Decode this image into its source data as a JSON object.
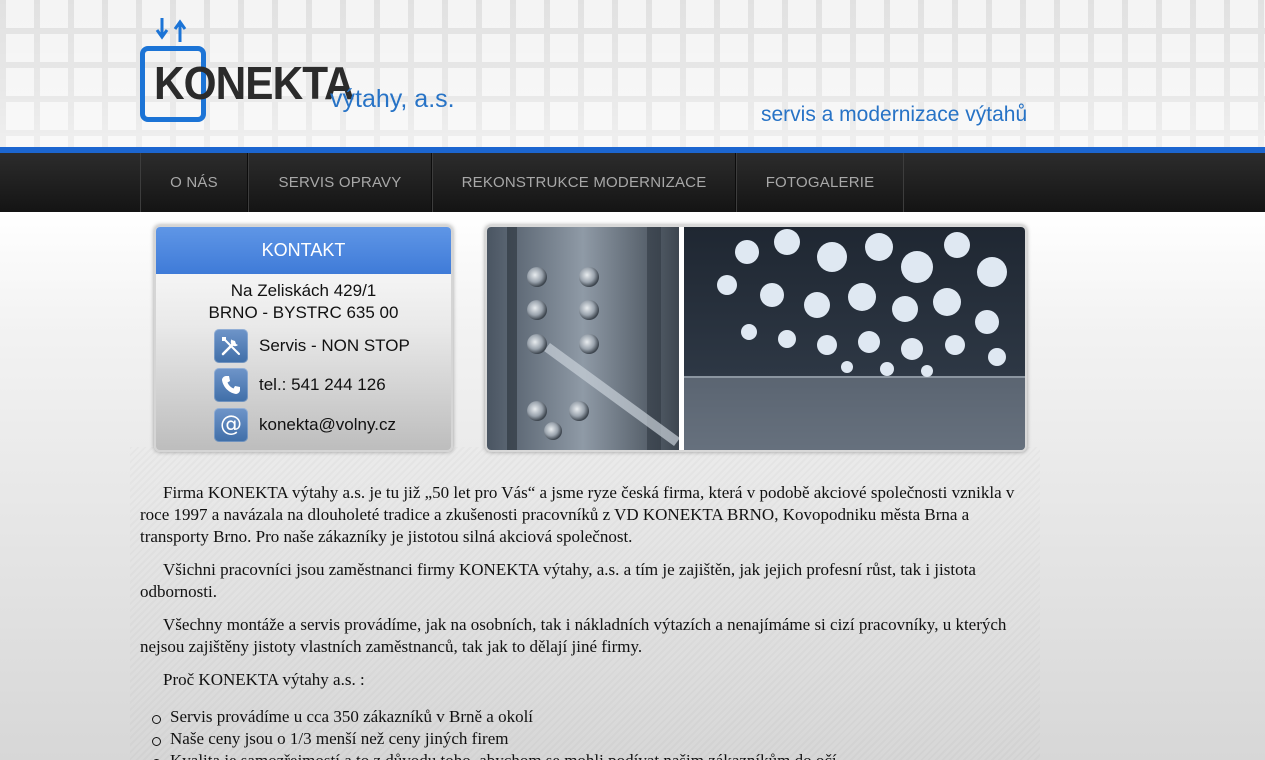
{
  "header": {
    "logo_text": "KONEKTA",
    "company_suffix": "výtahy, a.s.",
    "tagline": "servis a modernizace výtahů",
    "accent_color": "#1c66d0"
  },
  "nav": {
    "items": [
      {
        "label": "O NÁS"
      },
      {
        "label": "SERVIS OPRAVY"
      },
      {
        "label": "REKONSTRUKCE MODERNIZACE"
      },
      {
        "label": "FOTOGALERIE"
      }
    ]
  },
  "contact": {
    "title": "KONTAKT",
    "address_line1": "Na Zeliskách 429/1",
    "address_line2": "BRNO - BYSTRC 635 00",
    "rows": [
      {
        "icon": "tools-icon",
        "text": "Servis - NON STOP"
      },
      {
        "icon": "phone-icon",
        "text": "tel.: 541 244 126"
      },
      {
        "icon": "at-sign-icon",
        "text": "konekta@volny.cz"
      }
    ]
  },
  "article": {
    "paragraphs": [
      "Firma KONEKTA výtahy a.s. je tu již „50 let pro Vás“ a jsme ryze česká firma, která v podobě akciové společnosti vznikla v roce 1997 a navázala na dlouholeté tradice a zkušenosti pracovníků z VD KONEKTA BRNO, Kovopodniku města Brna a transporty Brno. Pro naše zákazníky je jistotou silná akciová společnost.",
      "Všichni pracovníci jsou zaměstnanci firmy KONEKTA výtahy, a.s. a tím je zajištěn, jak jejich profesní růst, tak i jistota odbornosti.",
      "Všechny montáže a servis provádíme, jak na osobních, tak i nákladních výtazích a nenajímáme si cizí pracovníky, u kterých nejsou zajištěny jistoty vlastních zaměstnanců, tak jak to dělají jiné firmy.",
      "Proč KONEKTA výtahy a.s. :"
    ],
    "bullets": [
      "Servis provádíme u cca 350 zákazníků v Brně a okolí",
      "Naše ceny jsou o 1/3 menší než ceny jiných firem",
      "Kvalita je samozřejmostí a to z důvodu toho, abychom se mohli podívat našim zákazníkům do očí"
    ]
  }
}
